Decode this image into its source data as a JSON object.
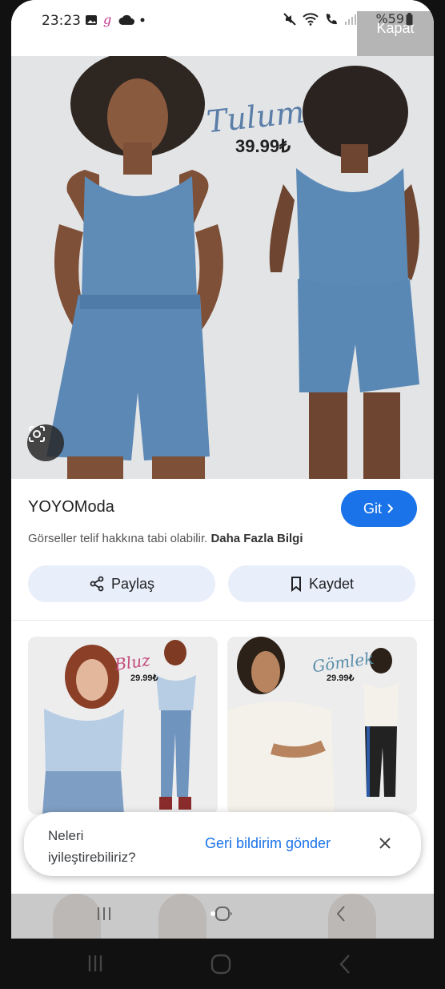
{
  "status_bar": {
    "time": "23:23",
    "battery": "%59",
    "close_label": "Kapat"
  },
  "hero": {
    "title": "Tulum",
    "price": "39.99₺"
  },
  "result": {
    "source_name": "YOYOModa",
    "visit_label": "Git",
    "copyright_text": "Görseller telif hakkına tabi olabilir.",
    "more_info_label": "Daha Fazla Bilgi",
    "share_label": "Paylaş",
    "save_label": "Kaydet"
  },
  "related": [
    {
      "title": "Bluz",
      "price": "29.99₺"
    },
    {
      "title": "Gömlek",
      "price": "29.99₺"
    }
  ],
  "feedback": {
    "prompt": "Neleri iyileştirebiliriz?",
    "action_label": "Geri bildirim gönder"
  },
  "colors": {
    "accent": "#1a73e8",
    "chip_bg": "#e8eefa"
  }
}
